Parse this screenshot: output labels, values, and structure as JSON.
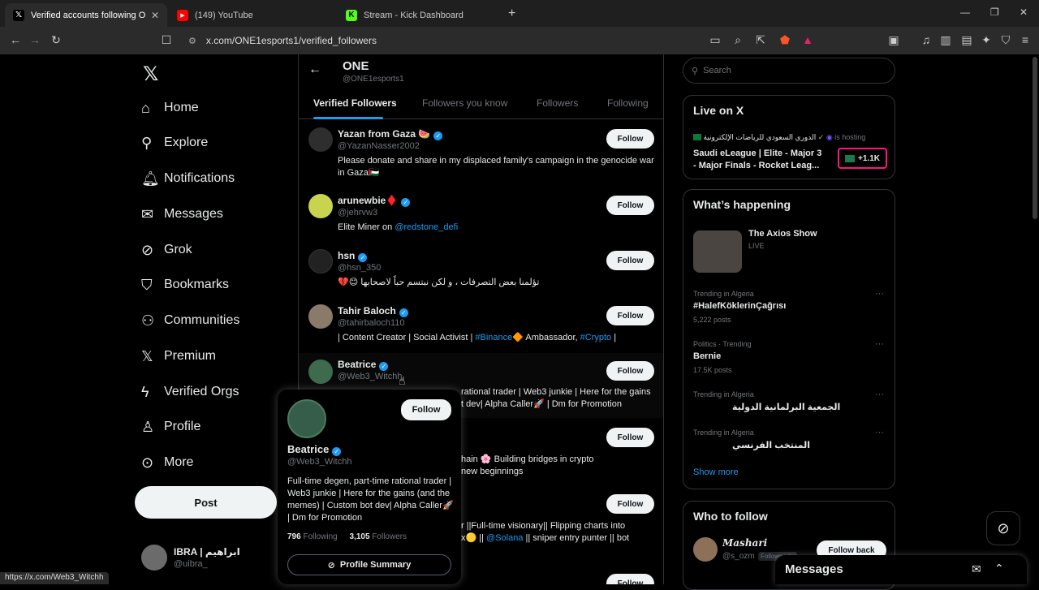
{
  "browser": {
    "tabs": [
      {
        "title": "Verified accounts following ONE",
        "favicon": "x-icon",
        "active": true
      },
      {
        "title": "(149) YouTube",
        "favicon": "youtube-icon",
        "active": false
      },
      {
        "title": "Stream - Kick Dashboard",
        "favicon": "kick-icon",
        "active": false
      }
    ],
    "url": "x.com/ONE1esports1/verified_followers",
    "status_url": "https://x.com/Web3_Witchh"
  },
  "nav": {
    "items": [
      {
        "label": "Home",
        "icon": "home-icon"
      },
      {
        "label": "Explore",
        "icon": "search-icon"
      },
      {
        "label": "Notifications",
        "icon": "bell-icon"
      },
      {
        "label": "Messages",
        "icon": "envelope-icon"
      },
      {
        "label": "Grok",
        "icon": "grok-icon"
      },
      {
        "label": "Bookmarks",
        "icon": "bookmark-icon"
      },
      {
        "label": "Communities",
        "icon": "people-icon"
      },
      {
        "label": "Premium",
        "icon": "x-icon"
      },
      {
        "label": "Verified Orgs",
        "icon": "lightning-icon"
      },
      {
        "label": "Profile",
        "icon": "person-icon"
      },
      {
        "label": "More",
        "icon": "more-icon"
      }
    ],
    "post_label": "Post",
    "account": {
      "name": "IBRA | ابراهيم",
      "handle": "@uibra_"
    }
  },
  "header": {
    "title": "ONE",
    "handle": "@ONE1esports1"
  },
  "tabs": [
    "Verified Followers",
    "Followers you know",
    "Followers",
    "Following"
  ],
  "follow_label": "Follow",
  "followers": [
    {
      "name": "Yazan from Gaza 🍉",
      "handle": "@YazanNasser2002",
      "bio": "Please donate and share in my displaced family's campaign in the genocide war in Gaza🇵🇸"
    },
    {
      "name": "arunewbie♦️",
      "handle": "@jehrvw3",
      "bio_text": "Elite Miner on ",
      "bio_link": "@redstone_defi"
    },
    {
      "name": "hsn",
      "handle": "@hsn_350",
      "bio": "تؤلمنا بعض التصرفات ، و لكن نبتسم حباً لاصحابها 😊💔"
    },
    {
      "name": "Tahir Baloch",
      "handle": "@tahirbaloch110",
      "bio_a": "| Content Creator | Social Activist | ",
      "bio_link1": "#Binance",
      "bio_b": "🔶 Ambassador, ",
      "bio_link2": "#Crypto",
      "bio_c": " |"
    },
    {
      "name": "Beatrice",
      "handle": "@Web3_Witchh",
      "bio_line1": "rational trader | Web3 junkie | Here for the gains",
      "bio_line2": "t dev| Alpha Caller🚀 | Dm for Promotion"
    },
    {
      "bio_line1": "hain 🌸 Building bridges in crypto",
      "bio_line2": "new beginnings"
    },
    {
      "bio_line1": "r ||Full-time visionary|| Flipping charts into",
      "bio_pre": "x🟡 || ",
      "bio_link": "@Solana",
      "bio_post": " || sniper entry punter || bot"
    }
  ],
  "popup": {
    "name": "Beatrice",
    "handle": "@Web3_Witchh",
    "bio": "Full-time degen, part-time rational trader | Web3 junkie | Here for the gains (and the memes) | Custom bot dev| Alpha Caller🚀 | Dm for Promotion",
    "following_count": "796",
    "following_label": "Following",
    "followers_count": "3,105",
    "followers_label": "Followers",
    "follow_label": "Follow",
    "summary_label": "Profile Summary"
  },
  "search": {
    "placeholder": "Search"
  },
  "live": {
    "title": "Live on X",
    "host": "الدوري السعودي للرياضات الإلكترونية",
    "hosting": "is hosting",
    "event": "Saudi eLeague | Elite - Major 3 - Major Finals - Rocket Leag...",
    "count": "+1.1K"
  },
  "happening": {
    "title": "What’s happening",
    "show": {
      "name": "The Axios Show",
      "status": "LIVE"
    },
    "trends": [
      {
        "context": "Trending in Algeria",
        "name": "#HalefKöklerinÇağrısı",
        "posts": "5,222 posts"
      },
      {
        "context": "Politics · Trending",
        "name": "Bernie",
        "posts": "17.5K posts"
      },
      {
        "context": "Trending in Algeria",
        "name": "الجمعية البرلمانية الدولية",
        "posts": ""
      },
      {
        "context": "Trending in Algeria",
        "name": "المنتخب الفرنسي",
        "posts": ""
      }
    ],
    "show_more": "Show more"
  },
  "who_to_follow": {
    "title": "Who to follow",
    "user": {
      "name": "Mashari",
      "handle": "@s_ozm",
      "follows_you": "Follows you"
    },
    "follow_back": "Follow back"
  },
  "messages": {
    "title": "Messages"
  },
  "colors": {
    "accent": "#1d9bf0",
    "live_border": "#f91880",
    "background": "#000000",
    "border": "#2f3336"
  }
}
